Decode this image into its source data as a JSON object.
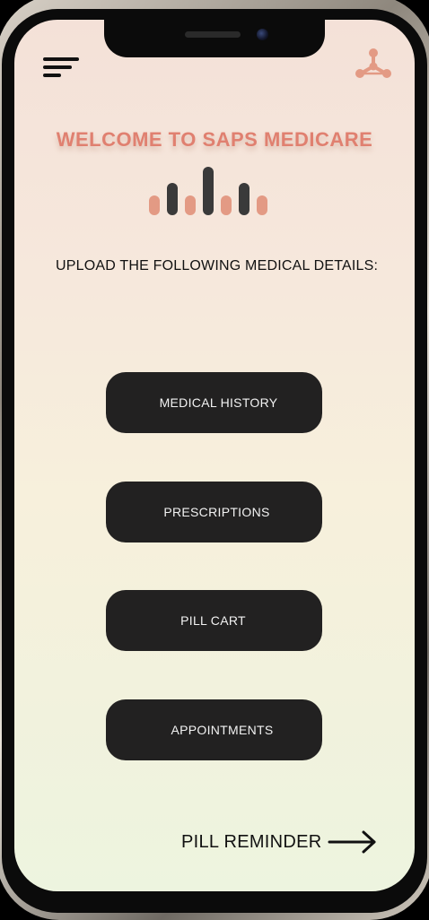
{
  "header": {
    "menu_icon": "hamburger-menu-icon",
    "logo_icon": "molecule-network-icon"
  },
  "welcome_title": "WELCOME TO SAPS MEDICARE",
  "equalizer": {
    "icon": "audio-bars-icon",
    "colors": [
      "#e39a84",
      "#3a3a3a",
      "#e39a84",
      "#3a3a3a",
      "#e39a84",
      "#3a3a3a",
      "#e39a84"
    ]
  },
  "upload_prompt": "UPLOAD THE FOLLOWING MEDICAL DETAILS:",
  "buttons": {
    "medical_history": "MEDICAL HISTORY",
    "prescriptions": "PRESCRIPTIONS",
    "pill_cart": "PILL CART",
    "appointments": "APPOINTMENTS"
  },
  "footer": {
    "pill_reminder": "PILL REMINDER",
    "arrow_icon": "arrow-right-icon"
  },
  "colors": {
    "accent": "#e08070",
    "button_bg": "#222121",
    "button_text": "#f2f2f2"
  }
}
